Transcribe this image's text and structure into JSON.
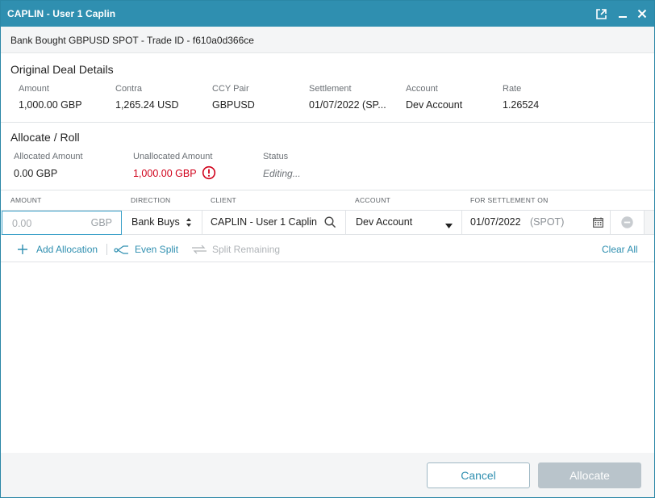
{
  "window": {
    "title": "CAPLIN - User 1 Caplin",
    "subtitle": "Bank Bought GBPUSD SPOT - Trade ID - f610a0d366ce",
    "accent_color": "#2f8fb0"
  },
  "deal": {
    "section_title": "Original Deal Details",
    "fields": [
      {
        "label": "Amount",
        "value": "1,000.00 GBP"
      },
      {
        "label": "Contra",
        "value": "1,265.24 USD"
      },
      {
        "label": "CCY Pair",
        "value": "GBPUSD"
      },
      {
        "label": "Settlement",
        "value": "01/07/2022 (SP..."
      },
      {
        "label": "Account",
        "value": "Dev Account"
      },
      {
        "label": "Rate",
        "value": "1.26524"
      }
    ]
  },
  "allocate": {
    "section_title": "Allocate / Roll",
    "allocated_label": "Allocated Amount",
    "allocated_value": "0.00 GBP",
    "unallocated_label": "Unallocated Amount",
    "unallocated_value": "1,000.00 GBP",
    "unallocated_color": "#d0021b",
    "status_label": "Status",
    "status_value": "Editing..."
  },
  "table": {
    "headers": [
      "AMOUNT",
      "DIRECTION",
      "CLIENT",
      "ACCOUNT",
      "FOR SETTLEMENT ON"
    ],
    "row": {
      "amount_placeholder": "0.00",
      "amount_ccy": "GBP",
      "direction": "Bank Buys",
      "client": "CAPLIN - User 1 Caplin",
      "account": "Dev Account",
      "settlement_date": "01/07/2022",
      "settlement_tenor": "(SPOT)"
    }
  },
  "actions": {
    "add_allocation": "Add Allocation",
    "even_split": "Even Split",
    "split_remaining": "Split Remaining",
    "clear_all": "Clear All"
  },
  "footer": {
    "cancel": "Cancel",
    "allocate": "Allocate"
  }
}
